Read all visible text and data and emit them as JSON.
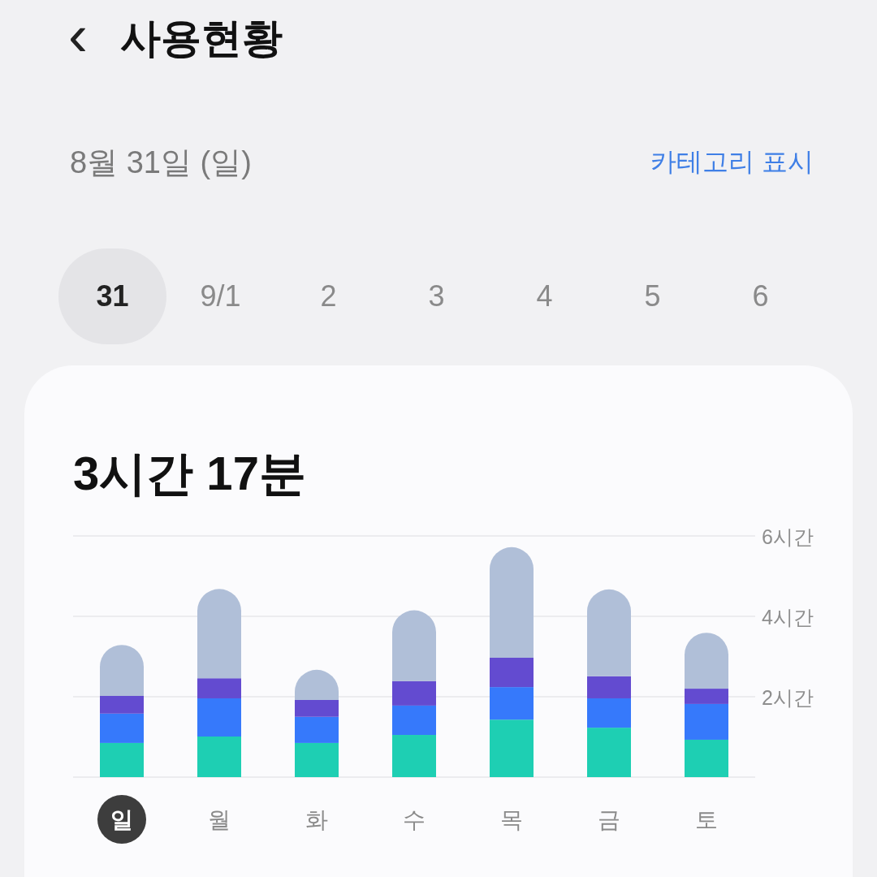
{
  "header": {
    "back": "‹",
    "title": "사용현황"
  },
  "date": {
    "label": "8월 31일 (일)",
    "action": "카테고리 표시"
  },
  "days": [
    {
      "label": "31",
      "selected": true
    },
    {
      "label": "9/1",
      "selected": false
    },
    {
      "label": "2",
      "selected": false
    },
    {
      "label": "3",
      "selected": false
    },
    {
      "label": "4",
      "selected": false
    },
    {
      "label": "5",
      "selected": false
    },
    {
      "label": "6",
      "selected": false
    }
  ],
  "usage": {
    "total": "3시간 17분",
    "chart_data": {
      "type": "bar",
      "stacked": true,
      "categories": [
        "일",
        "월",
        "화",
        "수",
        "목",
        "금",
        "토"
      ],
      "ylim": [
        0,
        6
      ],
      "yticks": [
        {
          "value": 2,
          "label": "2시간"
        },
        {
          "value": 4,
          "label": "4시간"
        },
        {
          "value": 6,
          "label": "6시간"
        }
      ],
      "series": [
        {
          "color": "#1ecfb3",
          "values": [
            0.85,
            1.01,
            0.85,
            1.05,
            1.43,
            1.23,
            0.93
          ]
        },
        {
          "color": "#3679fb",
          "values": [
            0.73,
            0.95,
            0.65,
            0.73,
            0.81,
            0.73,
            0.89
          ]
        },
        {
          "color": "#634bd0",
          "values": [
            0.44,
            0.5,
            0.42,
            0.61,
            0.73,
            0.55,
            0.38
          ]
        },
        {
          "color": "#b0bfd8",
          "values": [
            1.27,
            2.22,
            0.75,
            1.76,
            2.75,
            2.16,
            1.39
          ]
        }
      ]
    },
    "x_labels": [
      {
        "selected": true
      },
      {
        "selected": false
      },
      {
        "selected": false
      },
      {
        "selected": false
      },
      {
        "selected": false
      },
      {
        "selected": false
      },
      {
        "selected": false
      }
    ]
  }
}
